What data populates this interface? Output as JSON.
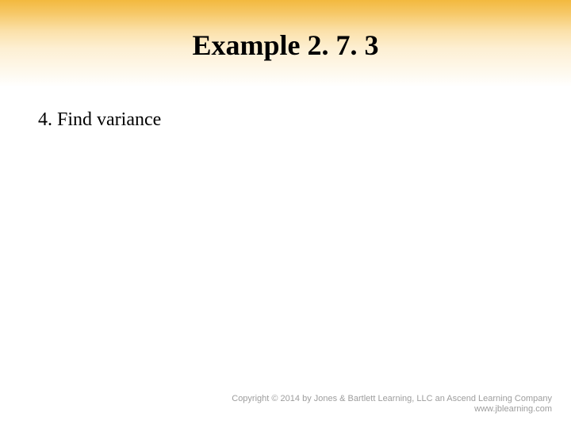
{
  "slide": {
    "title": "Example 2. 7. 3",
    "body": "4. Find variance"
  },
  "footer": {
    "copyright": "Copyright © 2014 by Jones & Bartlett Learning, LLC an Ascend Learning Company",
    "url": "www.jblearning.com"
  }
}
